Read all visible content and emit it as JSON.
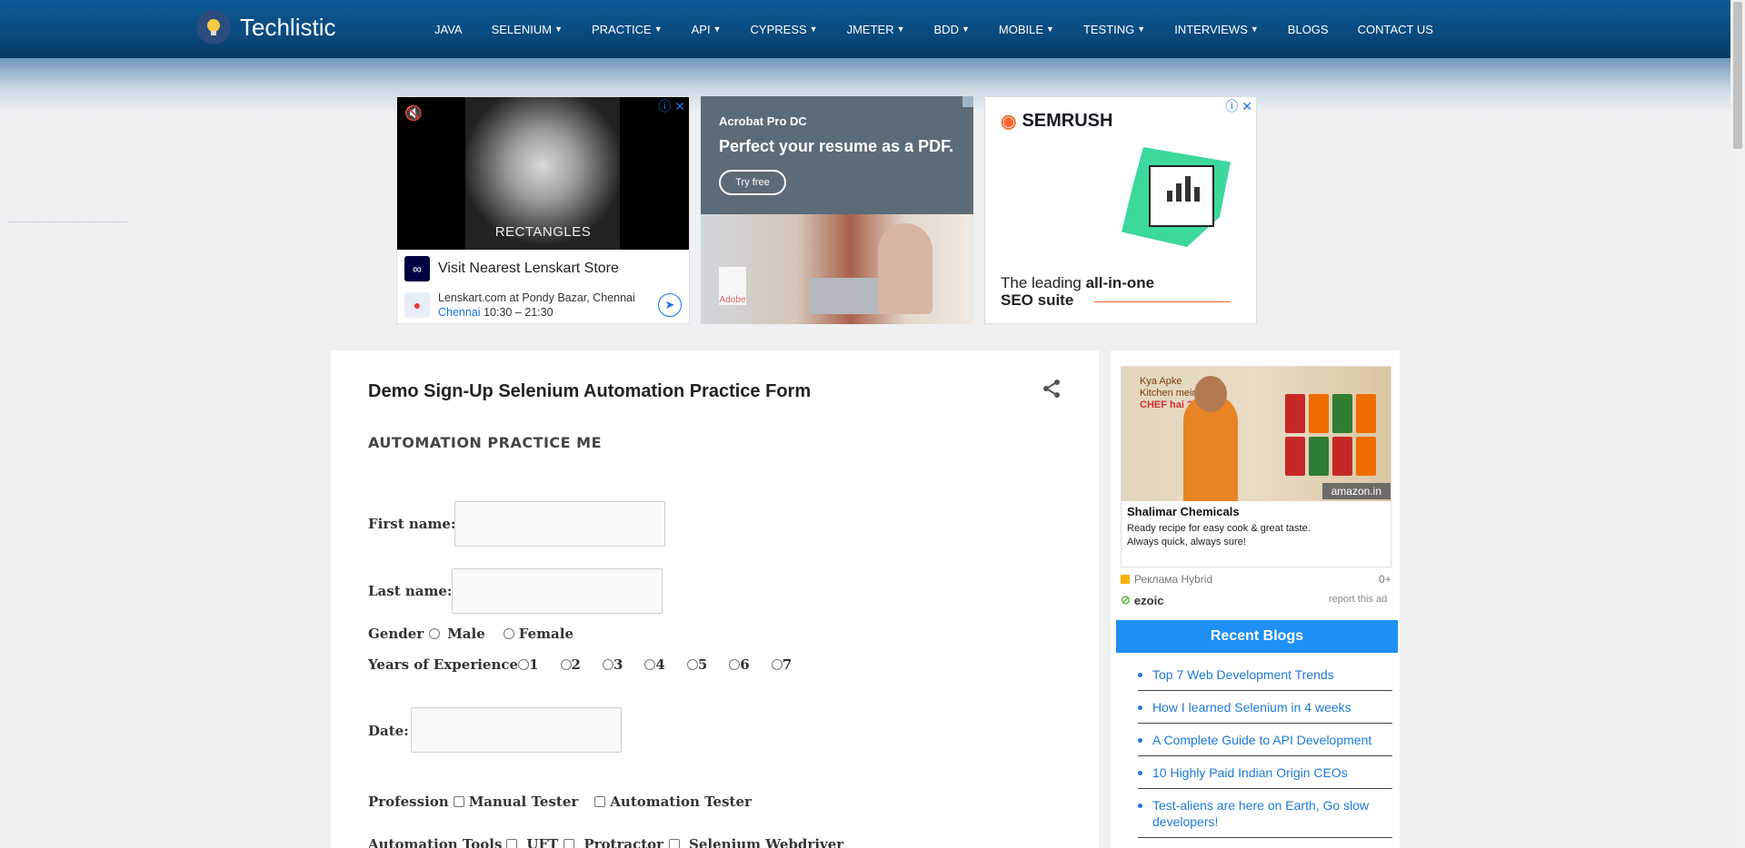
{
  "brand": {
    "name": "Techlistic"
  },
  "nav": [
    {
      "label": "JAVA",
      "dropdown": false
    },
    {
      "label": "SELENIUM",
      "dropdown": true
    },
    {
      "label": "PRACTICE",
      "dropdown": true
    },
    {
      "label": "API",
      "dropdown": true
    },
    {
      "label": "CYPRESS",
      "dropdown": true
    },
    {
      "label": "JMETER",
      "dropdown": true
    },
    {
      "label": "BDD",
      "dropdown": true
    },
    {
      "label": "MOBILE",
      "dropdown": true
    },
    {
      "label": "TESTING",
      "dropdown": true
    },
    {
      "label": "INTERVIEWS",
      "dropdown": true
    },
    {
      "label": "BLOGS",
      "dropdown": false
    },
    {
      "label": "CONTACT US",
      "dropdown": false
    }
  ],
  "ads": {
    "lenskart": {
      "video_caption": "RECTANGLES",
      "title": "Visit Nearest Lenskart Store",
      "address": "Lenskart.com at Pondy Bazar, Chennai",
      "city": "Chennai",
      "hours": "10:30 – 21:30",
      "logo_text": "∞"
    },
    "adobe": {
      "product": "Acrobat Pro DC",
      "headline": "Perfect your resume as a PDF.",
      "cta": "Try free",
      "brand": "Adobe"
    },
    "semrush": {
      "brand": "SEMRUSH",
      "tagline_prefix": "The leading ",
      "tagline_bold": "all-in-one",
      "tagline_second": "SEO suite"
    },
    "sidebar": {
      "headline_line1": "Kya Apke",
      "headline_line2": "Kitchen mein",
      "headline_line3": "CHEF hai ?",
      "store": "amazon.in",
      "title": "Shalimar Chemicals",
      "desc_line1": "Ready recipe for easy cook & great taste.",
      "desc_line2": "Always quick, always sure!",
      "network": "Реклама Hybrid",
      "rating": "0+",
      "ezoic": "ezoic",
      "report": "report this ad"
    }
  },
  "main": {
    "title": "Demo Sign-Up Selenium Automation Practice Form",
    "section": "AUTOMATION PRACTICE ME",
    "first_name_label": "First name:",
    "last_name_label": "Last name:",
    "gender_label": "Gender",
    "gender_options": [
      "Male",
      "Female"
    ],
    "experience_label": "Years of Experience",
    "experience_options": [
      "1",
      "2",
      "3",
      "4",
      "5",
      "6",
      "7"
    ],
    "date_label": "Date:",
    "profession_label": "Profession",
    "profession_options": [
      "Manual Tester",
      "Automation Tester"
    ],
    "tools_label": "Automation Tools",
    "tools_options": [
      "UFT",
      "Protractor",
      "Selenium Webdriver"
    ]
  },
  "sidebar": {
    "recent_title": "Recent Blogs",
    "blogs": [
      "Top 7 Web Development Trends",
      "How I learned Selenium in 4 weeks",
      "A Complete Guide to API Development",
      "10 Highly Paid Indian Origin CEOs",
      "Test-aliens are here on Earth, Go slow developers!"
    ]
  },
  "colors": {
    "header": "#0b5591",
    "recent_header": "#1e8ff4",
    "link": "#1e7ad7"
  }
}
